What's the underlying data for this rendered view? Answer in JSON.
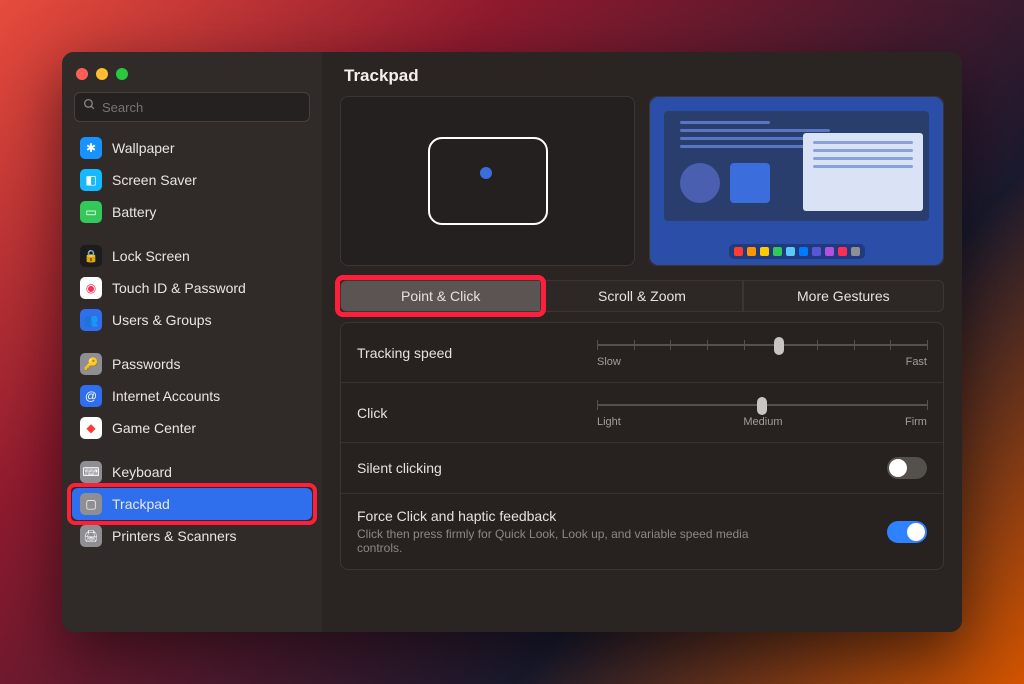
{
  "window": {
    "title": "Trackpad"
  },
  "search": {
    "placeholder": "Search"
  },
  "sidebar": {
    "items": [
      {
        "label": "Wallpaper",
        "icon_bg": "#1793ff",
        "glyph": "✱"
      },
      {
        "label": "Screen Saver",
        "icon_bg": "#14b9ff",
        "glyph": "◧"
      },
      {
        "label": "Battery",
        "icon_bg": "#34c759",
        "glyph": "▭"
      },
      {
        "label": "Lock Screen",
        "icon_bg": "#1c1c1e",
        "glyph": "🔒"
      },
      {
        "label": "Touch ID & Password",
        "icon_bg": "#ffffff",
        "glyph": "◉",
        "glyph_color": "#ff2d55"
      },
      {
        "label": "Users & Groups",
        "icon_bg": "#2f6fed",
        "glyph": "👥"
      },
      {
        "label": "Passwords",
        "icon_bg": "#8e8e93",
        "glyph": "🔑"
      },
      {
        "label": "Internet Accounts",
        "icon_bg": "#2f6fed",
        "glyph": "@"
      },
      {
        "label": "Game Center",
        "icon_bg": "#ffffff",
        "glyph": "◆",
        "glyph_color": "#ff3b30"
      },
      {
        "label": "Keyboard",
        "icon_bg": "#8e8e93",
        "glyph": "⌨"
      },
      {
        "label": "Trackpad",
        "icon_bg": "#8e8e93",
        "glyph": "▢",
        "selected": true,
        "highlight": true
      },
      {
        "label": "Printers & Scanners",
        "icon_bg": "#8e8e93",
        "glyph": "🖨"
      }
    ]
  },
  "tabs": [
    {
      "label": "Point & Click",
      "active": true,
      "highlight": true
    },
    {
      "label": "Scroll & Zoom"
    },
    {
      "label": "More Gestures"
    }
  ],
  "settings": {
    "tracking_speed": {
      "label": "Tracking speed",
      "min_label": "Slow",
      "max_label": "Fast",
      "value_pct": 55
    },
    "click": {
      "label": "Click",
      "min_label": "Light",
      "mid_label": "Medium",
      "max_label": "Firm",
      "value_pct": 50
    },
    "silent_clicking": {
      "label": "Silent clicking",
      "on": false
    },
    "force_click": {
      "label": "Force Click and haptic feedback",
      "sub": "Click then press firmly for Quick Look, Look up, and variable speed media controls.",
      "on": true
    }
  },
  "dock_colors": [
    "#ff3b30",
    "#ff9500",
    "#ffcc00",
    "#34c759",
    "#5ac8fa",
    "#007aff",
    "#5856d6",
    "#af52de",
    "#ff2d55",
    "#8e8e93"
  ]
}
